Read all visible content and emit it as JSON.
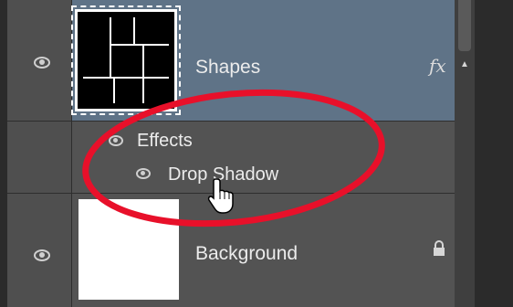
{
  "layers": [
    {
      "name": "Shapes",
      "fx_label": "fx",
      "selected": true
    },
    {
      "name": "Background",
      "locked": true
    }
  ],
  "effects": {
    "header_label": "Effects",
    "items": [
      {
        "label": "Drop Shadow"
      }
    ]
  },
  "colors": {
    "selected_row": "#5f7387",
    "panel_bg": "#535353",
    "annotation_red": "#e8102a"
  },
  "icons": {
    "visibility": "eye-icon",
    "fx_badge": "fx-icon",
    "lock": "lock-icon",
    "cursor": "hand-pointer-icon",
    "scroll": "scroll-up-arrow-icon"
  }
}
